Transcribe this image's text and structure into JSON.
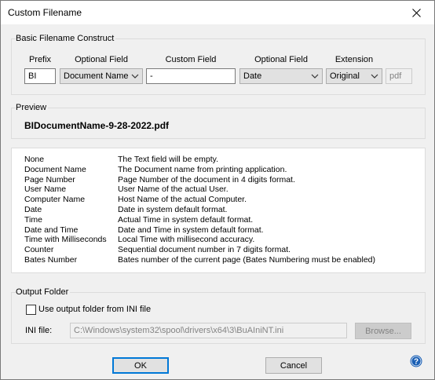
{
  "window": {
    "title": "Custom Filename"
  },
  "basic": {
    "group_label": "Basic Filename Construct",
    "columns": {
      "prefix": "Prefix",
      "optional_field_1": "Optional Field",
      "custom_field": "Custom Field",
      "optional_field_2": "Optional Field",
      "extension": "Extension"
    },
    "prefix_value": "BI",
    "optional_field_1_value": "Document Name",
    "custom_field_value": "-",
    "optional_field_2_value": "Date",
    "extension_value": "Original",
    "extension_text": "pdf"
  },
  "preview": {
    "group_label": "Preview",
    "text": "BIDocumentName-9-28-2022.pdf"
  },
  "legend": [
    {
      "term": "None",
      "desc": "The Text field will be empty."
    },
    {
      "term": "Document Name",
      "desc": "The Document name from printing application."
    },
    {
      "term": "Page Number",
      "desc": "Page Number of the document in 4 digits format."
    },
    {
      "term": "User Name",
      "desc": "User Name of the actual User."
    },
    {
      "term": "Computer Name",
      "desc": "Host Name of the actual Computer."
    },
    {
      "term": "Date",
      "desc": "Date in system default format."
    },
    {
      "term": "Time",
      "desc": "Actual Time in system default format."
    },
    {
      "term": "Date and Time",
      "desc": "Date and Time in system default format."
    },
    {
      "term": "Time with Milliseconds",
      "desc": "Local Time with millisecond accuracy."
    },
    {
      "term": "Counter",
      "desc": "Sequential document number in 7 digits format."
    },
    {
      "term": "Bates Number",
      "desc": "Bates number of the current page (Bates Numbering must be enabled)"
    }
  ],
  "output": {
    "group_label": "Output Folder",
    "checkbox_label": "Use output folder from INI file",
    "ini_label": "INI file:",
    "ini_path": "C:\\Windows\\system32\\spool\\drivers\\x64\\3\\BuAIniNT.ini",
    "browse_label": "Browse..."
  },
  "buttons": {
    "ok": "OK",
    "cancel": "Cancel"
  },
  "colors": {
    "accent": "#0078d7",
    "help_icon": "#1a5fb4"
  }
}
